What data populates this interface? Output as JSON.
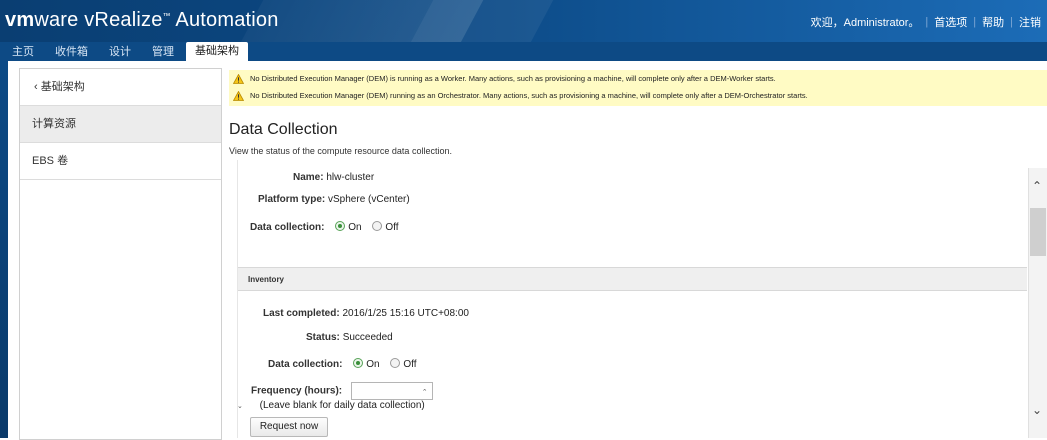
{
  "header": {
    "brand_vm": "vm",
    "brand_ware": "ware",
    "brand_product": "vRealize",
    "brand_suite": "Automation",
    "welcome": "欢迎，Administrator。",
    "preferences": "首选项",
    "help": "帮助",
    "logout": "注销"
  },
  "tabs": [
    {
      "label": "主页"
    },
    {
      "label": "收件箱"
    },
    {
      "label": "设计"
    },
    {
      "label": "管理"
    },
    {
      "label": "基础架构",
      "active": true
    }
  ],
  "sidebar": {
    "back": "‹ 基础架构",
    "items": [
      {
        "label": "计算资源",
        "active": true
      },
      {
        "label": "EBS 卷"
      }
    ]
  },
  "warnings": [
    "No Distributed Execution Manager (DEM) is running as a Worker. Many actions, such as provisioning a machine, will complete only after a DEM-Worker starts.",
    "No Distributed Execution Manager (DEM) running as an Orchestrator. Many actions, such as provisioning a machine, will complete only after a DEM-Orchestrator starts."
  ],
  "page": {
    "title": "Data Collection",
    "subtitle": "View the status of the compute resource data collection."
  },
  "resource": {
    "name_label": "Name:",
    "name_value": "hlw-cluster",
    "platform_label": "Platform type:",
    "platform_value": "vSphere (vCenter)",
    "collection_label": "Data collection:",
    "on": "On",
    "off": "Off"
  },
  "inventory": {
    "section_title": "Inventory",
    "last_completed_label": "Last completed:",
    "last_completed_value": "2016/1/25 15:16 UTC+08:00",
    "status_label": "Status:",
    "status_value": "Succeeded",
    "collection_label": "Data collection:",
    "on": "On",
    "off": "Off",
    "frequency_label": "Frequency (hours):",
    "frequency_value": "",
    "frequency_hint": "(Leave blank for daily data collection)",
    "request_button": "Request now"
  },
  "colors": {
    "header_bg": "#0c4a86",
    "warning_bg": "#fffbc4",
    "radio_on": "#3a8f3a"
  }
}
